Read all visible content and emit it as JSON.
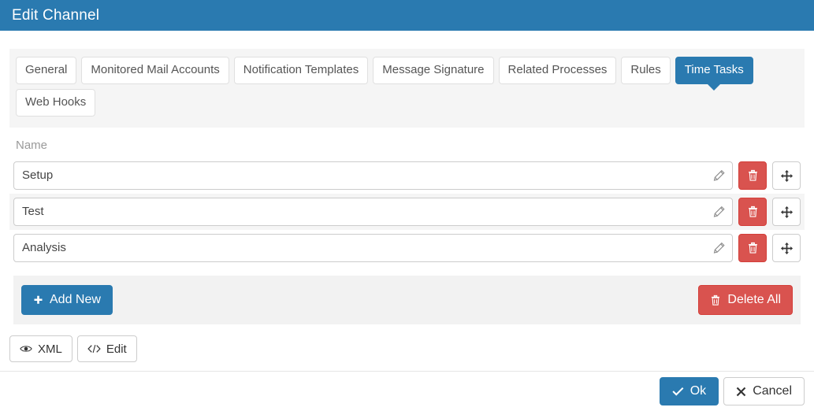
{
  "window": {
    "title": "Edit Channel",
    "header_color": "#2a7ab0"
  },
  "tabs": {
    "items": [
      {
        "label": "General",
        "active": false
      },
      {
        "label": "Monitored Mail Accounts",
        "active": false
      },
      {
        "label": "Notification Templates",
        "active": false
      },
      {
        "label": "Message Signature",
        "active": false
      },
      {
        "label": "Related Processes",
        "active": false
      },
      {
        "label": "Rules",
        "active": false
      },
      {
        "label": "Time Tasks",
        "active": true
      },
      {
        "label": "Web Hooks",
        "active": false
      }
    ],
    "active_label": "Time Tasks"
  },
  "table": {
    "column_header": "Name",
    "rows": [
      {
        "name": "Setup",
        "edit_icon": "pencil-icon",
        "delete_icon": "trash-icon",
        "move_icon": "move-icon"
      },
      {
        "name": "Test",
        "edit_icon": "pencil-icon",
        "delete_icon": "trash-icon",
        "move_icon": "move-icon"
      },
      {
        "name": "Analysis",
        "edit_icon": "pencil-icon",
        "delete_icon": "trash-icon",
        "move_icon": "move-icon"
      }
    ]
  },
  "actions": {
    "add_new_label": "Add New",
    "add_new_icon": "plus-icon",
    "delete_all_label": "Delete All",
    "delete_all_icon": "trash-icon",
    "primary_color": "#2a7ab0",
    "danger_color": "#d9534f"
  },
  "tools": {
    "xml_label": "XML",
    "xml_icon": "eye-icon",
    "edit_label": "Edit",
    "edit_icon": "code-icon"
  },
  "footer": {
    "ok_label": "Ok",
    "ok_icon": "check-icon",
    "cancel_label": "Cancel",
    "cancel_icon": "times-icon"
  }
}
